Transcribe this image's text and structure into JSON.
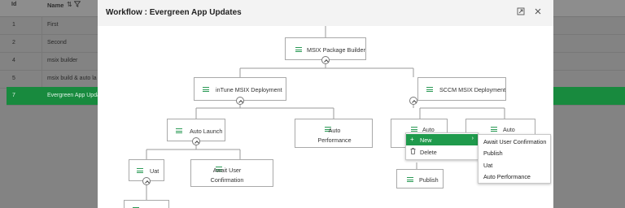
{
  "background_grid": {
    "headers": {
      "id": "Id",
      "name": "Name"
    },
    "icons": {
      "sort": "sort-icon",
      "filter": "filter-icon"
    },
    "rows": [
      {
        "id": "1",
        "name": "First"
      },
      {
        "id": "2",
        "name": "Second"
      },
      {
        "id": "4",
        "name": "msix builder"
      },
      {
        "id": "5",
        "name": "msix build & auto la"
      },
      {
        "id": "7",
        "name": "Evergreen App Upda",
        "selected": true
      }
    ],
    "selected_color": "#188a3e"
  },
  "modal": {
    "title": "Workflow : Evergreen App Updates",
    "buttons": {
      "maximize": "maximize-icon",
      "close": "close-icon"
    }
  },
  "tree": {
    "root": "MSIX Package Builder",
    "intune": "inTune MSIX Deployment",
    "sccm": "SCCM MSIX Deployment",
    "auto_launch": "Auto Launch",
    "auto_performance": "Auto Performance",
    "sccm_auto_1": "Auto",
    "sccm_auto_2": "Auto",
    "uat": "Uat",
    "await_user_confirmation": "Await User Confirmation",
    "publish": "Publish",
    "accent_color": "#2a9a55"
  },
  "context_menu": {
    "new": "New",
    "delete": "Delete",
    "active_color": "#1f9a4c"
  },
  "submenu": {
    "items": [
      "Await User Confirmation",
      "Publish",
      "Uat",
      "Auto Performance"
    ]
  }
}
